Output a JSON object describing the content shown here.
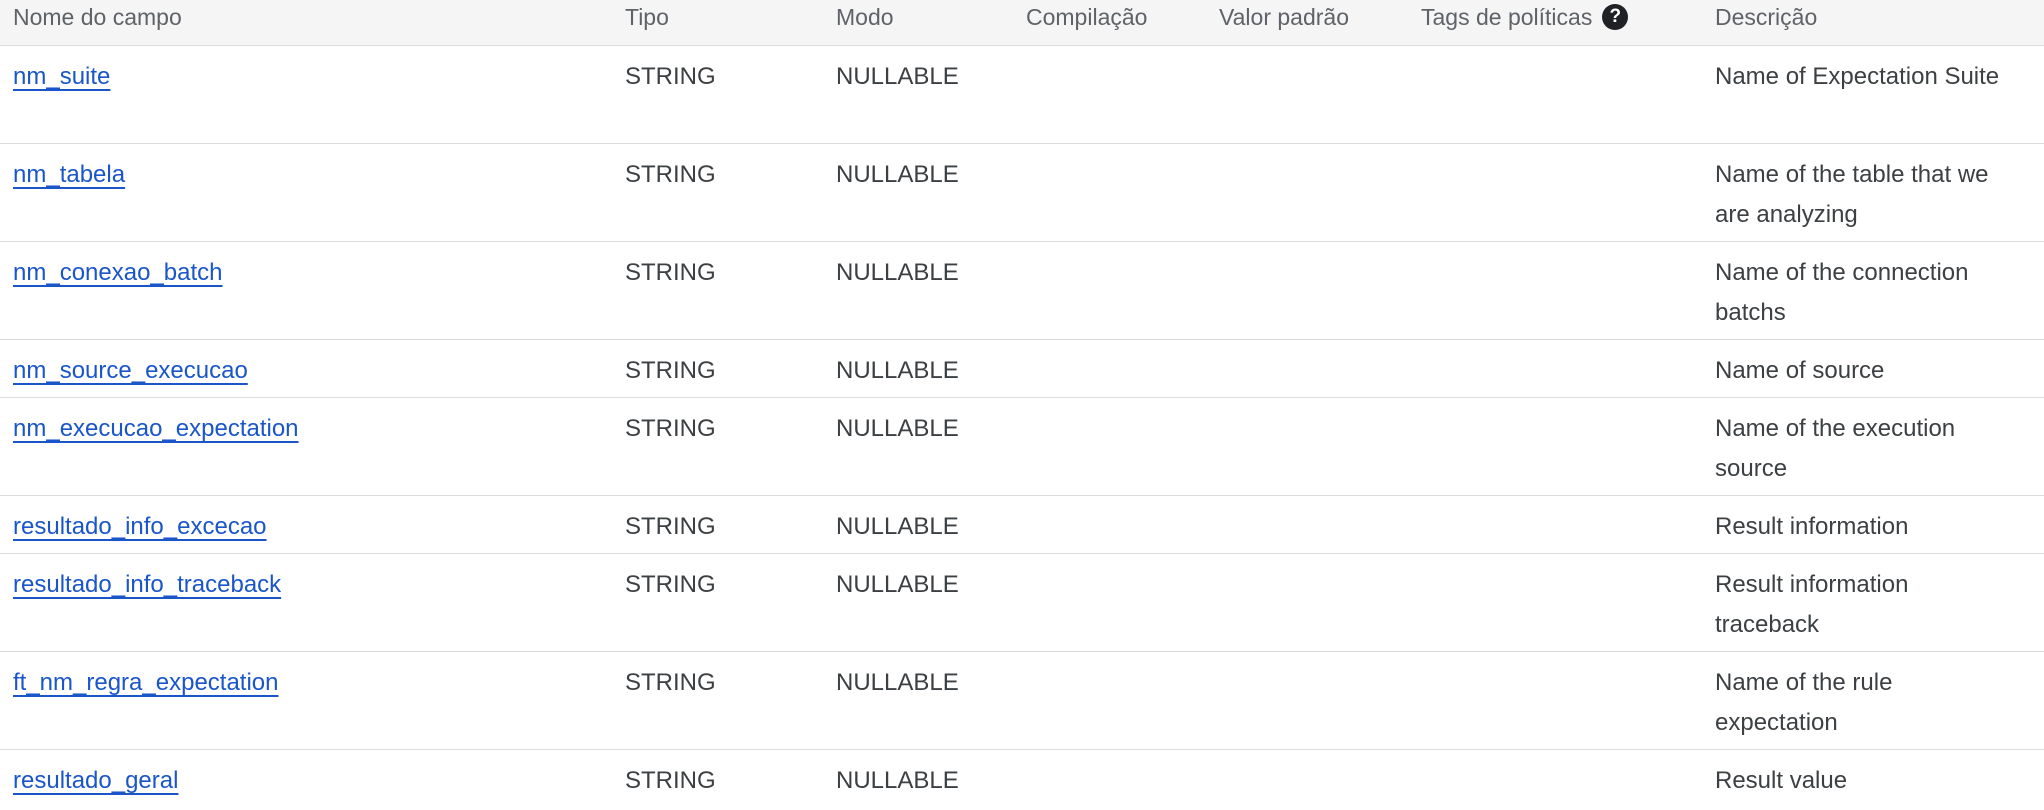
{
  "columns": {
    "name": "Nome do campo",
    "type": "Tipo",
    "mode": "Modo",
    "compilation": "Compilação",
    "default_value": "Valor padrão",
    "policy_tags": "Tags de políticas",
    "description": "Descrição"
  },
  "icons": {
    "help": "help-circle-icon"
  },
  "rows": [
    {
      "name": "nm_suite",
      "type": "STRING",
      "mode": "NULLABLE",
      "description": "Name of Expectation Suite"
    },
    {
      "name": "nm_tabela",
      "type": "STRING",
      "mode": "NULLABLE",
      "description": "Name of the table that we are analyzing"
    },
    {
      "name": "nm_conexao_batch",
      "type": "STRING",
      "mode": "NULLABLE",
      "description": "Name of the connection batchs"
    },
    {
      "name": "nm_source_execucao",
      "type": "STRING",
      "mode": "NULLABLE",
      "description": "Name of source"
    },
    {
      "name": "nm_execucao_expectation",
      "type": "STRING",
      "mode": "NULLABLE",
      "description": "Name of the execution source"
    },
    {
      "name": "resultado_info_excecao",
      "type": "STRING",
      "mode": "NULLABLE",
      "description": "Result information"
    },
    {
      "name": "resultado_info_traceback",
      "type": "STRING",
      "mode": "NULLABLE",
      "description": "Result information traceback"
    },
    {
      "name": "ft_nm_regra_expectation",
      "type": "STRING",
      "mode": "NULLABLE",
      "description": "Name of the rule expectation"
    },
    {
      "name": "resultado_geral",
      "type": "STRING",
      "mode": "NULLABLE",
      "description": "Result value"
    }
  ]
}
